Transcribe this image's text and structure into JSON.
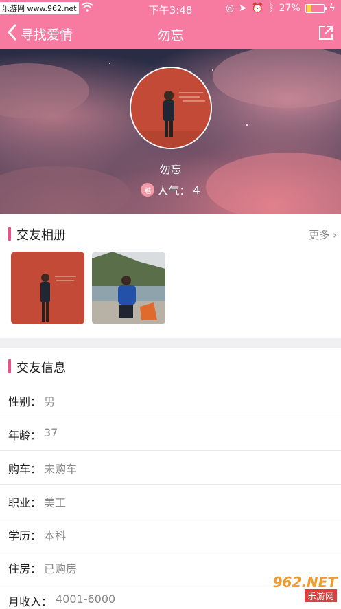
{
  "status_bar": {
    "carrier": "乐游网 www.962.net",
    "time": "下午3:48",
    "battery": "27%"
  },
  "nav": {
    "back_label": "寻找爱情",
    "title": "勿忘"
  },
  "profile": {
    "name": "勿忘",
    "heart_badge": "魅",
    "popularity_label": "人气：",
    "popularity_value": "4"
  },
  "album": {
    "title": "交友相册",
    "more_label": "更多 ›"
  },
  "info": {
    "title": "交友信息",
    "rows": [
      {
        "label": "性别：",
        "value": "男"
      },
      {
        "label": "年龄：",
        "value": "37"
      },
      {
        "label": "购车：",
        "value": "未购车"
      },
      {
        "label": "职业：",
        "value": "美工"
      },
      {
        "label": "学历：",
        "value": "本科"
      },
      {
        "label": "住房：",
        "value": "已购房"
      },
      {
        "label": "月收入：",
        "value": "4001-6000"
      }
    ]
  },
  "watermark": {
    "brand": "962.NET",
    "sub": "乐游网"
  },
  "colors": {
    "accent": "#f77aa0",
    "section_bar": "#f0508a"
  }
}
